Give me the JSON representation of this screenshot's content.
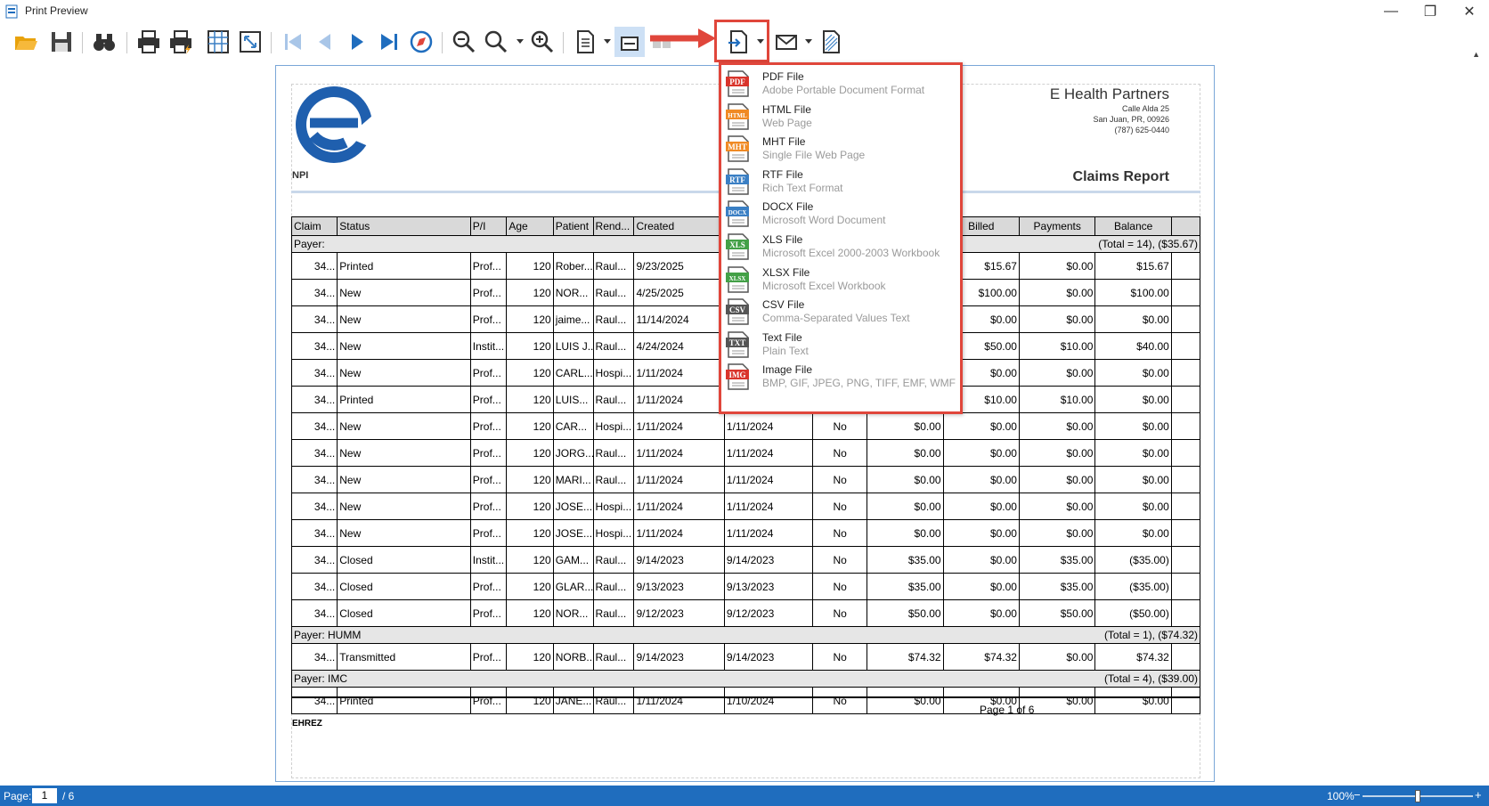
{
  "window": {
    "title": "Print Preview"
  },
  "report": {
    "company": "E Health Partners",
    "address1": "Calle Alda 25",
    "address2": "San Juan, PR, 00926",
    "phone": "(787) 625-0440",
    "npi": "NPI",
    "title": "Claims Report",
    "footer_page": "Page 1 of 6",
    "footer_user": "EHREZ"
  },
  "table": {
    "headers": [
      "Claim",
      "Status",
      "P/I",
      "Age",
      "Patient",
      "Rend...",
      "Created",
      "",
      "",
      "",
      "Billed",
      "Payments",
      "Balance",
      ""
    ],
    "groups": [
      {
        "label": "Payer:",
        "total": "(Total = 14), ($35.67)",
        "rows": [
          [
            "34...",
            "Printed",
            "Prof...",
            "120",
            "Rober...",
            "Raul...",
            "9/23/2025",
            "",
            "",
            "",
            "$15.67",
            "$0.00",
            "$15.67"
          ],
          [
            "34...",
            "New",
            "Prof...",
            "120",
            "NOR...",
            "Raul...",
            "4/25/2025",
            "",
            "",
            "",
            "$100.00",
            "$0.00",
            "$100.00"
          ],
          [
            "34...",
            "New",
            "Prof...",
            "120",
            "jaime...",
            "Raul...",
            "11/14/2024",
            "",
            "",
            "",
            "$0.00",
            "$0.00",
            "$0.00"
          ],
          [
            "34...",
            "New",
            "Instit...",
            "120",
            "LUIS J...",
            "Raul...",
            "4/24/2024",
            "",
            "",
            "",
            "$50.00",
            "$10.00",
            "$40.00"
          ],
          [
            "34...",
            "New",
            "Prof...",
            "120",
            "CARL...",
            "Hospi...",
            "1/11/2024",
            "",
            "",
            "",
            "$0.00",
            "$0.00",
            "$0.00"
          ],
          [
            "34...",
            "Printed",
            "Prof...",
            "120",
            "LUIS...",
            "Raul...",
            "1/11/2024",
            "",
            "",
            "",
            "$10.00",
            "$10.00",
            "$0.00"
          ],
          [
            "34...",
            "New",
            "Prof...",
            "120",
            "CAR...",
            "Hospi...",
            "1/11/2024",
            "1/11/2024",
            "No",
            "$0.00",
            "$0.00",
            "$0.00",
            "$0.00"
          ],
          [
            "34...",
            "New",
            "Prof...",
            "120",
            "JORG...",
            "Raul...",
            "1/11/2024",
            "1/11/2024",
            "No",
            "$0.00",
            "$0.00",
            "$0.00",
            "$0.00"
          ],
          [
            "34...",
            "New",
            "Prof...",
            "120",
            "MARI...",
            "Raul...",
            "1/11/2024",
            "1/11/2024",
            "No",
            "$0.00",
            "$0.00",
            "$0.00",
            "$0.00"
          ],
          [
            "34...",
            "New",
            "Prof...",
            "120",
            "JOSE...",
            "Hospi...",
            "1/11/2024",
            "1/11/2024",
            "No",
            "$0.00",
            "$0.00",
            "$0.00",
            "$0.00"
          ],
          [
            "34...",
            "New",
            "Prof...",
            "120",
            "JOSE...",
            "Hospi...",
            "1/11/2024",
            "1/11/2024",
            "No",
            "$0.00",
            "$0.00",
            "$0.00",
            "$0.00"
          ],
          [
            "34...",
            "Closed",
            "Instit...",
            "120",
            "GAM...",
            "Raul...",
            "9/14/2023",
            "9/14/2023",
            "No",
            "$35.00",
            "$0.00",
            "$35.00",
            "($35.00)"
          ],
          [
            "34...",
            "Closed",
            "Prof...",
            "120",
            "GLAR...",
            "Raul...",
            "9/13/2023",
            "9/13/2023",
            "No",
            "$35.00",
            "$0.00",
            "$35.00",
            "($35.00)"
          ],
          [
            "34...",
            "Closed",
            "Prof...",
            "120",
            "NOR...",
            "Raul...",
            "9/12/2023",
            "9/12/2023",
            "No",
            "$50.00",
            "$0.00",
            "$50.00",
            "($50.00)"
          ]
        ]
      },
      {
        "label": "Payer: HUMM",
        "total": "(Total = 1), ($74.32)",
        "rows": [
          [
            "34...",
            "Transmitted",
            "Prof...",
            "120",
            "NORB...",
            "Raul...",
            "9/14/2023",
            "9/14/2023",
            "No",
            "$74.32",
            "$74.32",
            "$0.00",
            "$74.32"
          ]
        ]
      },
      {
        "label": "Payer: IMC",
        "total": "(Total = 4), ($39.00)",
        "rows": [
          [
            "34...",
            "Printed",
            "Prof...",
            "120",
            "JANE...",
            "Raul...",
            "1/11/2024",
            "1/10/2024",
            "No",
            "$0.00",
            "$0.00",
            "$0.00",
            "$0.00"
          ]
        ]
      }
    ]
  },
  "export_menu": {
    "items": [
      {
        "title": "PDF File",
        "desc": "Adobe Portable Document Format",
        "icon": "PDF",
        "color": "#d9342b"
      },
      {
        "title": "HTML File",
        "desc": "Web Page",
        "icon": "HTML",
        "color": "#f08a24"
      },
      {
        "title": "MHT File",
        "desc": "Single File Web Page",
        "icon": "MHT",
        "color": "#f08a24"
      },
      {
        "title": "RTF File",
        "desc": "Rich Text Format",
        "icon": "RTF",
        "color": "#3a7fc4"
      },
      {
        "title": "DOCX File",
        "desc": "Microsoft Word Document",
        "icon": "DOCX",
        "color": "#3a7fc4"
      },
      {
        "title": "XLS File",
        "desc": "Microsoft Excel 2000-2003 Workbook",
        "icon": "XLS",
        "color": "#43a047"
      },
      {
        "title": "XLSX File",
        "desc": "Microsoft Excel Workbook",
        "icon": "XLSX",
        "color": "#43a047"
      },
      {
        "title": "CSV File",
        "desc": "Comma-Separated Values Text",
        "icon": "CSV",
        "color": "#555555"
      },
      {
        "title": "Text File",
        "desc": "Plain Text",
        "icon": "TXT",
        "color": "#555555"
      },
      {
        "title": "Image File",
        "desc": "BMP, GIF, JPEG, PNG, TIFF, EMF, WMF",
        "icon": "IMG",
        "color": "#d9342b"
      }
    ]
  },
  "status": {
    "page_label": "Page:",
    "page_value": "1",
    "page_total": "/ 6",
    "zoom": "100%",
    "zoom_fraction": 0.5
  },
  "colors": {
    "accent": "#1f6dbe",
    "highlight": "#e0463b"
  }
}
